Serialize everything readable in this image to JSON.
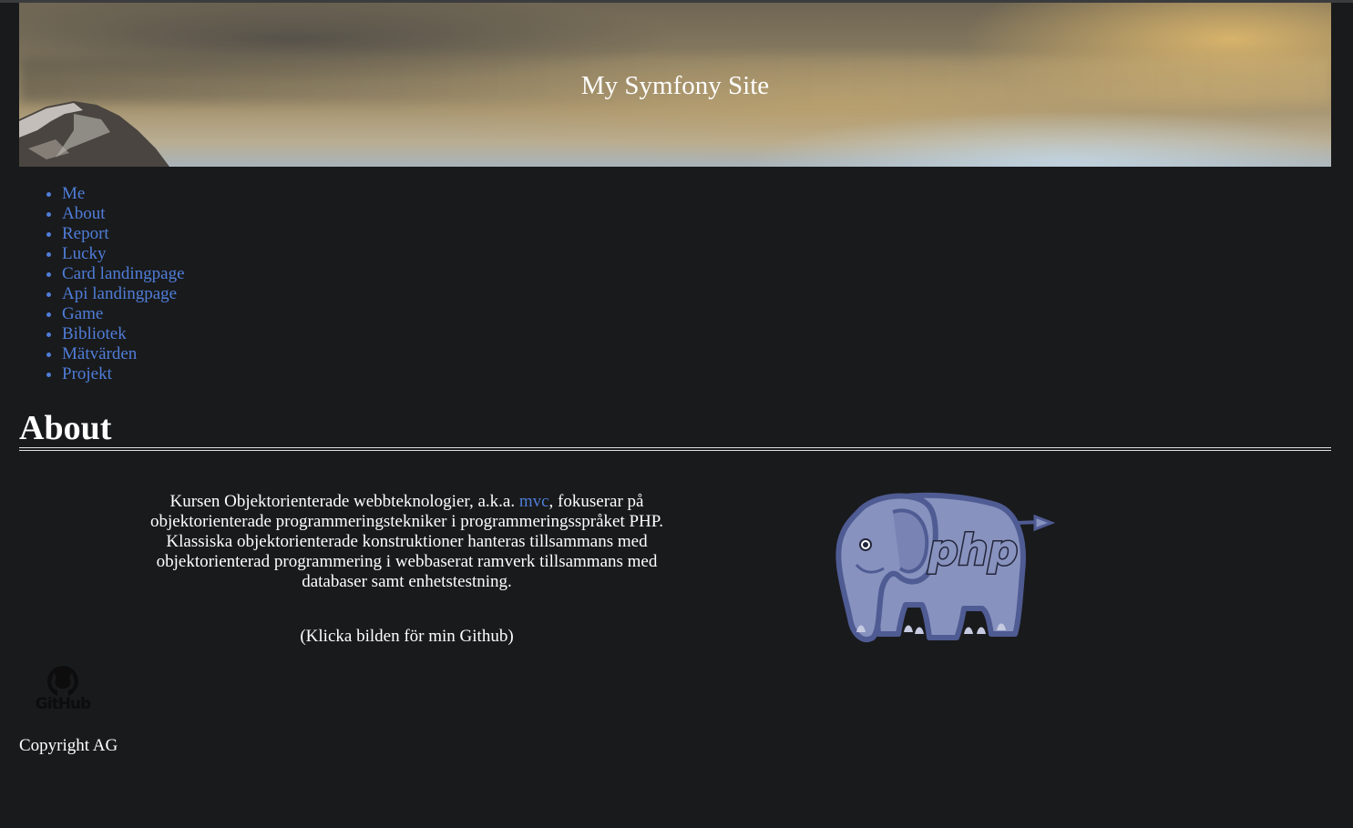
{
  "site": {
    "title": "My Symfony Site"
  },
  "nav": {
    "items": [
      {
        "label": "Me"
      },
      {
        "label": "About"
      },
      {
        "label": "Report"
      },
      {
        "label": "Lucky"
      },
      {
        "label": "Card landingpage"
      },
      {
        "label": "Api landingpage"
      },
      {
        "label": "Game"
      },
      {
        "label": "Bibliotek"
      },
      {
        "label": "Mätvärden"
      },
      {
        "label": "Projekt"
      }
    ]
  },
  "main": {
    "heading": "About",
    "intro_before_link": "Kursen Objektorienterade webbteknologier, a.k.a. ",
    "intro_link": "mvc",
    "intro_after_link": ", fokuserar på objektorienterade programmeringstekniker i programmeringsspråket PHP. Klassiska objektorienterade konstruktioner hanteras tillsammans med objektorienterad programmering i webbaserat ramverk tillsammans med databaser samt enhetstestning.",
    "hint": "(Klicka bilden för min Github)",
    "php_logo_text": "php",
    "github_label": "GitHub"
  },
  "footer": {
    "copyright": "Copyright AG"
  },
  "colors": {
    "background": "#191a1c",
    "link": "#4f7dd8",
    "text": "#ffffff",
    "php_elephant": "#8892bf"
  },
  "icons": {
    "php": "php-elephant-logo",
    "github": "github-octocat-icon"
  }
}
